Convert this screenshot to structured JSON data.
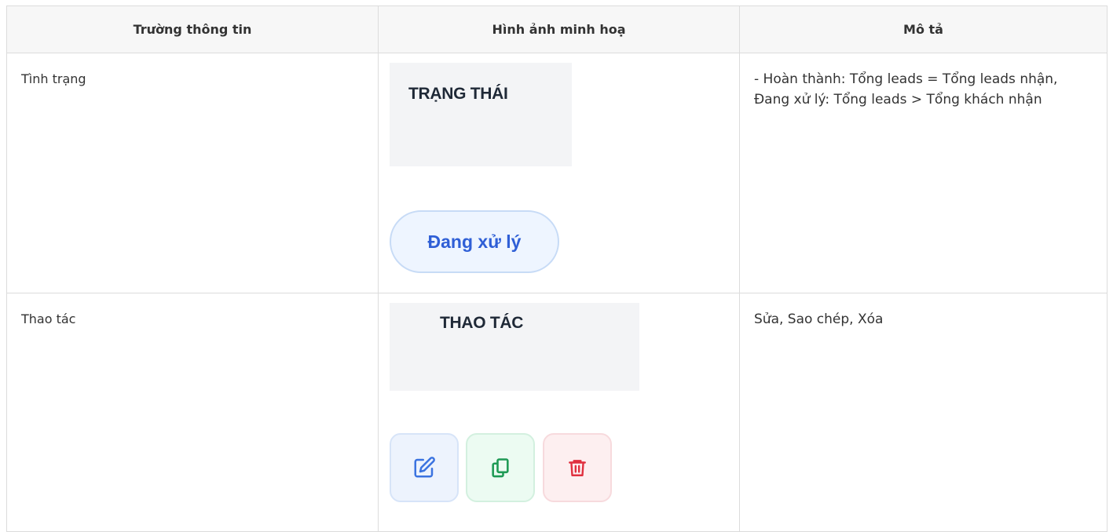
{
  "table": {
    "headers": [
      "Trường thông tin",
      "Hình ảnh minh hoạ",
      "Mô tả"
    ],
    "rows": [
      {
        "field": "Tình trạng",
        "illustration": {
          "header_label": "TRẠNG THÁI",
          "badge_label": "Đang xử lý",
          "badge_color": "#2f5fd6"
        },
        "description": "- Hoàn thành: Tổng leads = Tổng leads nhận, Đang xử lý: Tổng leads > Tổng khách nhận"
      },
      {
        "field": "Thao tác",
        "illustration": {
          "header_label": "THAO TÁC",
          "buttons": [
            {
              "icon": "edit-icon",
              "color": "#3b73e0"
            },
            {
              "icon": "copy-icon",
              "color": "#1e9a55"
            },
            {
              "icon": "trash-icon",
              "color": "#e0303f"
            }
          ]
        },
        "description": "Sửa, Sao chép, Xóa"
      }
    ]
  }
}
